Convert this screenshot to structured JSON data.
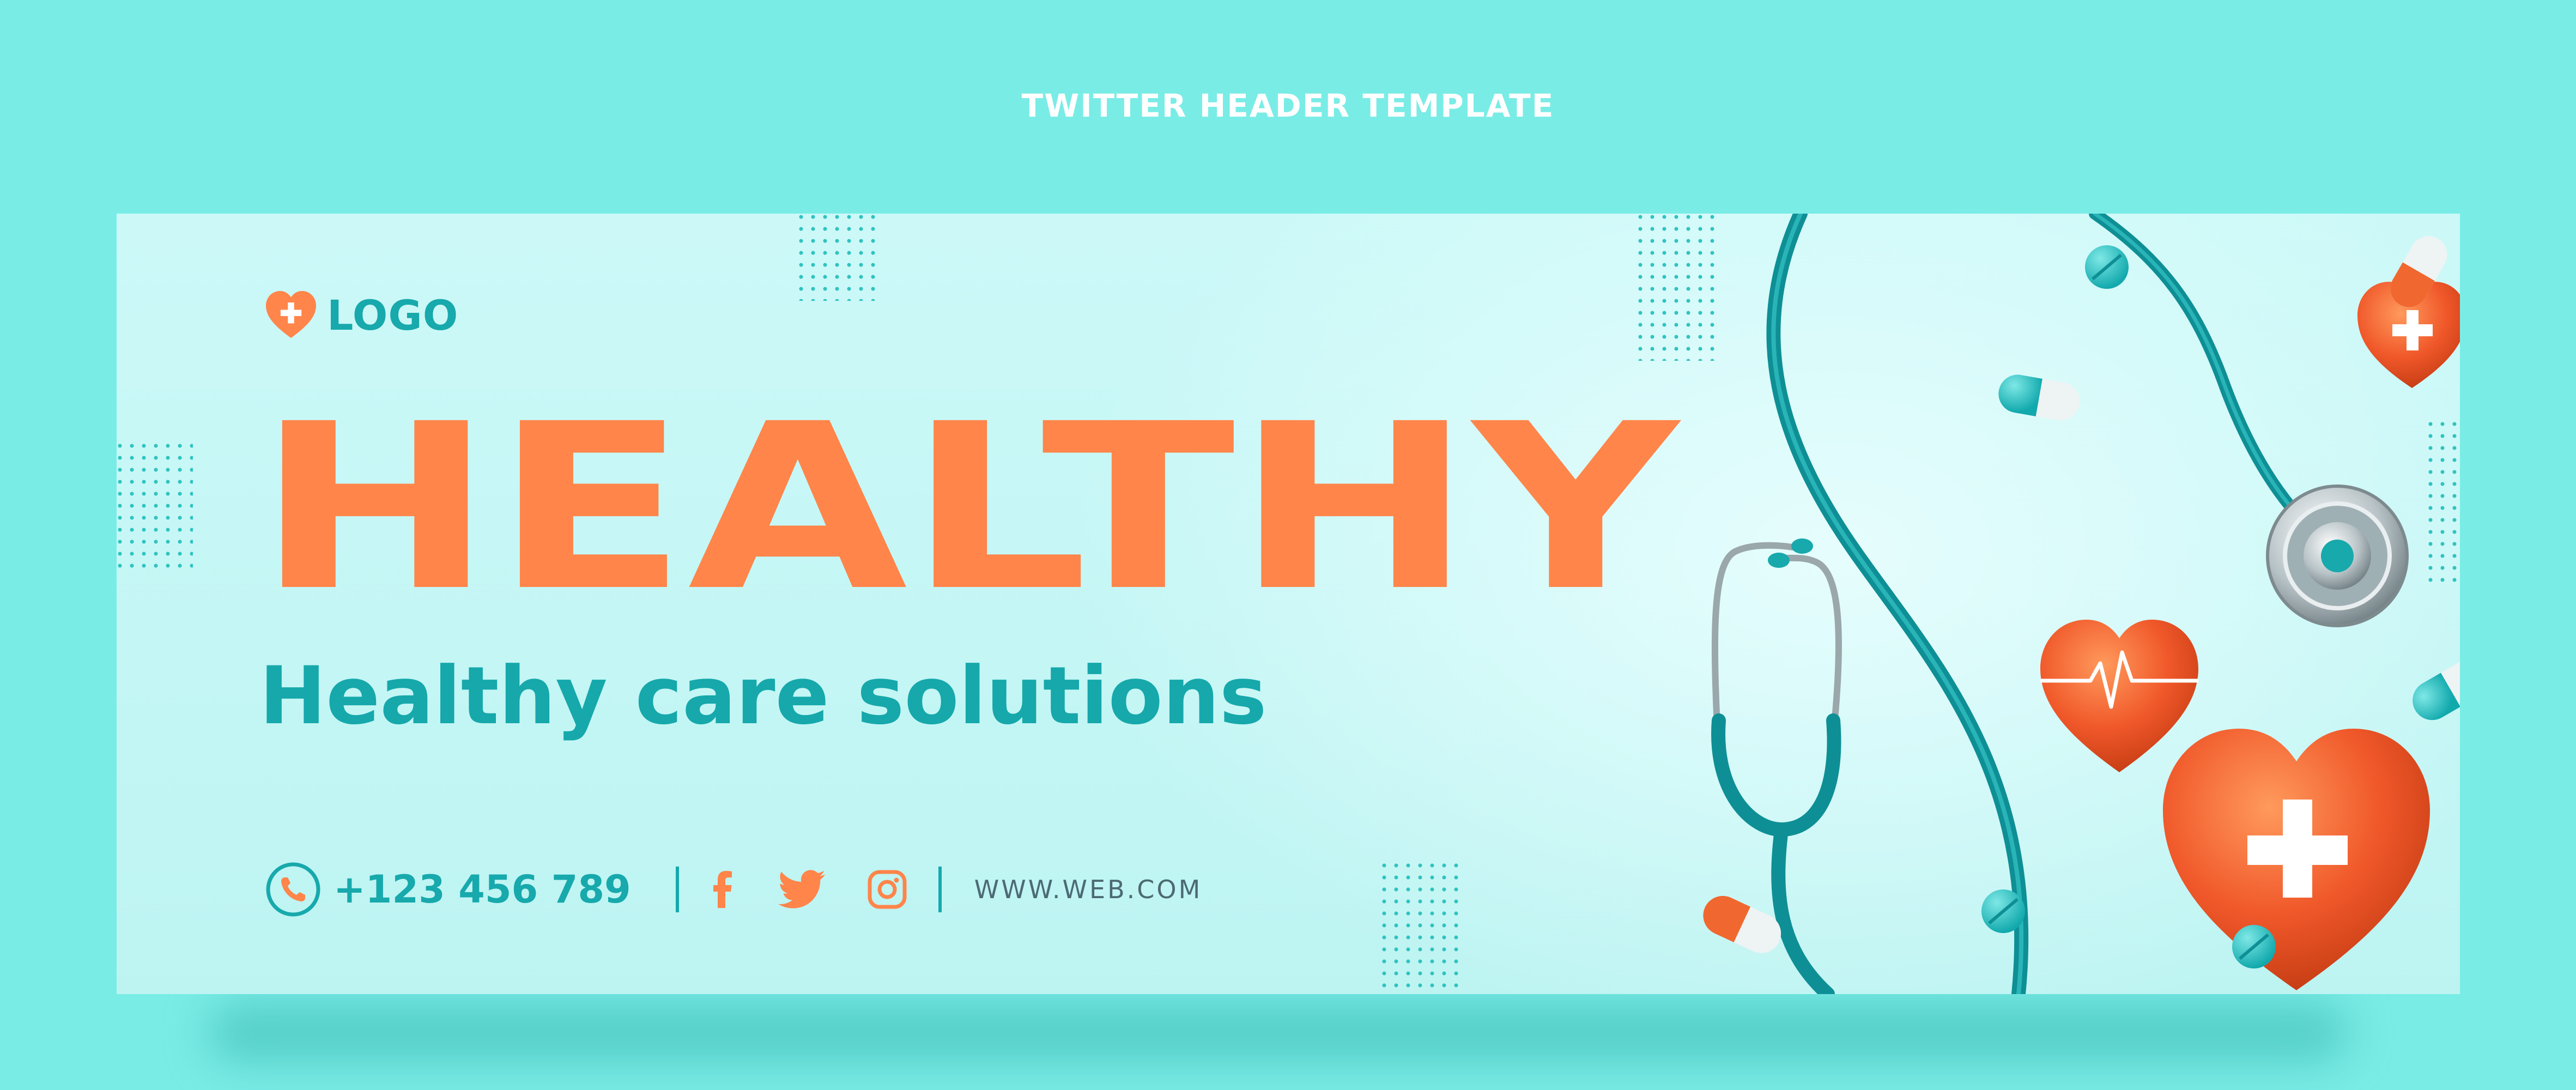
{
  "page": {
    "title": "TWITTER HEADER TEMPLATE"
  },
  "banner": {
    "logo_text": "LOGO",
    "headline": "HEALTHY",
    "subheadline": "Healthy care solutions",
    "phone": "+123 456 789",
    "website": "WWW.WEB.COM"
  },
  "icons": {
    "logo": "heart-plus-icon",
    "phone": "phone-icon",
    "facebook": "facebook-icon",
    "twitter": "twitter-icon",
    "instagram": "instagram-icon"
  },
  "colors": {
    "background": "#7aece6",
    "teal": "#17a9ac",
    "orange": "#ff854a",
    "card": "#c6f7f6"
  }
}
